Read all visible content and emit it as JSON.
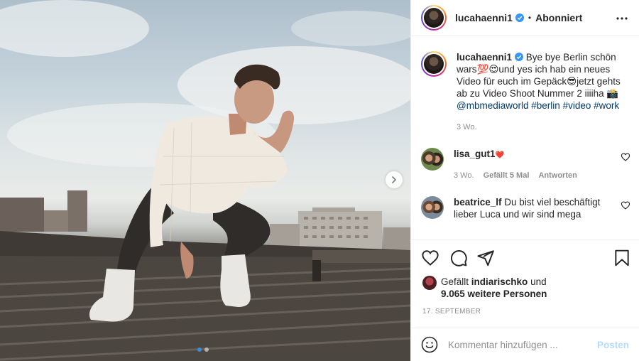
{
  "post": {
    "username": "lucahaenni1",
    "separator": "•",
    "follow_state": "Abonniert",
    "caption_before": " Bye bye Berlin schön wars",
    "caption_emoji1": "💯",
    "caption_emoji2": "😍",
    "caption_middle": "und yes ich hab ein neues Video für euch im Gepäck",
    "caption_emoji3": "😎",
    "caption_after": "jetzt gehts ab zu Video Shoot Nummer 2 iiiiha",
    "caption_emoji4": "📸",
    "mention": "@mbmediaworld",
    "tags": [
      "#berlin",
      "#video",
      "#work"
    ],
    "caption_time": "3 Wo."
  },
  "comments": [
    {
      "username": "lisa_gut1",
      "emoji": "❤️",
      "text": "",
      "time": "3 Wo.",
      "likes": "Gefällt 5 Mal",
      "reply": "Antworten"
    },
    {
      "username": "beatrice_lf",
      "text": " Du bist viel beschäftigt lieber Luca und wir sind mega"
    }
  ],
  "likes": {
    "prefix": "Gefällt ",
    "user": "indiarischko",
    "and": " und",
    "count": "9.065 weitere Personen"
  },
  "date": "17. SEPTEMBER",
  "add_comment": {
    "placeholder": "Kommentar hinzufügen ...",
    "post_label": "Posten"
  },
  "carousel": {
    "current": 1,
    "total": 2
  },
  "colors": {
    "link": "#00376b",
    "verified": "#3897f0",
    "post_disabled": "#b3dbff",
    "carousel_active": "#3d8ad6"
  },
  "icons": [
    "verified-icon",
    "more-icon",
    "next-arrow-icon",
    "heart-icon",
    "comment-icon",
    "share-icon",
    "bookmark-icon",
    "emoji-icon"
  ]
}
